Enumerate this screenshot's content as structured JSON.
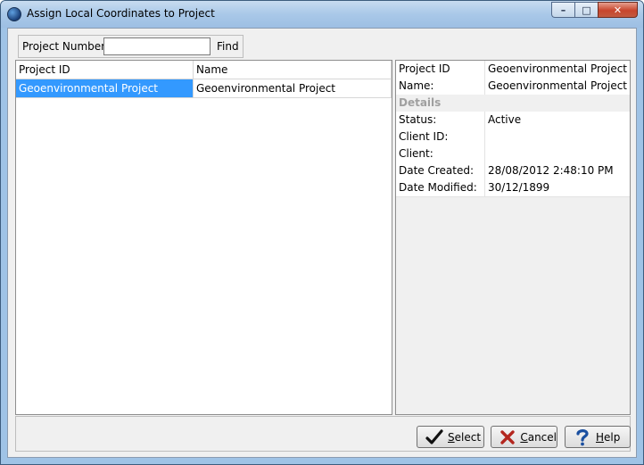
{
  "window": {
    "title": "Assign Local Coordinates to Project"
  },
  "caption": {
    "minimize": "–",
    "maximize": "□",
    "close": "✕"
  },
  "search": {
    "label": "Project Number:",
    "value": "",
    "find_label": "Find"
  },
  "grid": {
    "columns": [
      "Project ID",
      "Name"
    ],
    "rows": [
      {
        "project_id": "Geoenvironmental Project",
        "name": "Geoenvironmental Project"
      }
    ]
  },
  "details": {
    "project_id_label": "Project ID",
    "project_id": "Geoenvironmental Project",
    "name_label": "Name:",
    "name": "Geoenvironmental Project",
    "section_label": "Details",
    "status_label": "Status:",
    "status": "Active",
    "client_id_label": "Client ID:",
    "client_id": "",
    "client_label": "Client:",
    "client": "",
    "date_created_label": "Date Created:",
    "date_created": "28/08/2012 2:48:10 PM",
    "date_modified_label": "Date Modified:",
    "date_modified": "30/12/1899"
  },
  "buttons": {
    "select_first": "S",
    "select_rest": "elect",
    "cancel_first": "C",
    "cancel_rest": "ancel",
    "help_first": "H",
    "help_rest": "elp"
  },
  "colors": {
    "selection": "#3399ff",
    "title_gradient": "#a9c8e8",
    "close_red": "#c8452c"
  },
  "icons": {
    "select": "check-icon",
    "cancel": "x-icon",
    "help": "question-icon"
  }
}
